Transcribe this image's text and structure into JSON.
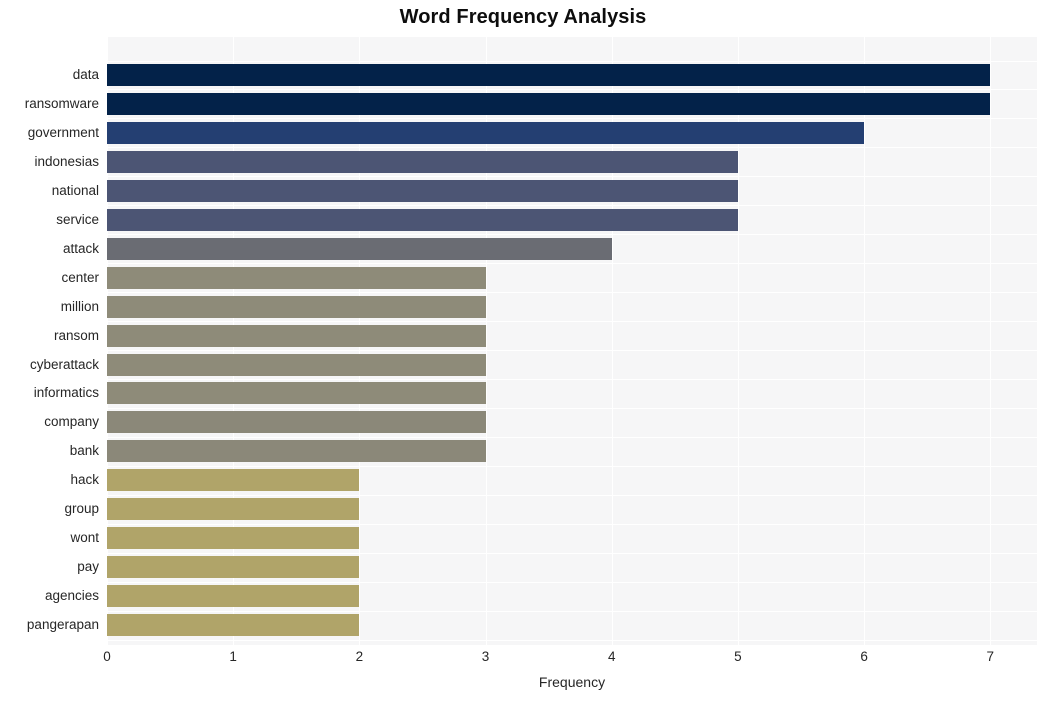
{
  "chart_data": {
    "type": "bar",
    "orientation": "horizontal",
    "title": "Word Frequency Analysis",
    "xlabel": "Frequency",
    "ylabel": "",
    "categories": [
      "data",
      "ransomware",
      "government",
      "indonesias",
      "national",
      "service",
      "attack",
      "center",
      "million",
      "ransom",
      "cyberattack",
      "informatics",
      "company",
      "bank",
      "hack",
      "group",
      "wont",
      "pay",
      "agencies",
      "pangerapan"
    ],
    "values": [
      7,
      7,
      6,
      5,
      5,
      5,
      4,
      3,
      3,
      3,
      3,
      3,
      3,
      3,
      2,
      2,
      2,
      2,
      2,
      2
    ],
    "bar_colors": [
      "#032249",
      "#032249",
      "#243f72",
      "#4c5574",
      "#4c5574",
      "#4c5574",
      "#6a6c73",
      "#8e8b79",
      "#8e8b79",
      "#8e8b79",
      "#8e8b79",
      "#8e8b79",
      "#8b8879",
      "#8b8879",
      "#b0a469",
      "#b0a469",
      "#b0a469",
      "#b0a469",
      "#b0a469",
      "#b0a469"
    ],
    "xlim": [
      0,
      7.37
    ],
    "xticks": [
      0,
      1,
      2,
      3,
      4,
      5,
      6,
      7
    ],
    "xtick_labels": [
      "0",
      "1",
      "2",
      "3",
      "4",
      "5",
      "6",
      "7"
    ],
    "grid": true,
    "grid_color": "#ffffff",
    "plot_background": "#f6f6f7",
    "figure_background": "#ffffff",
    "legend": null
  }
}
